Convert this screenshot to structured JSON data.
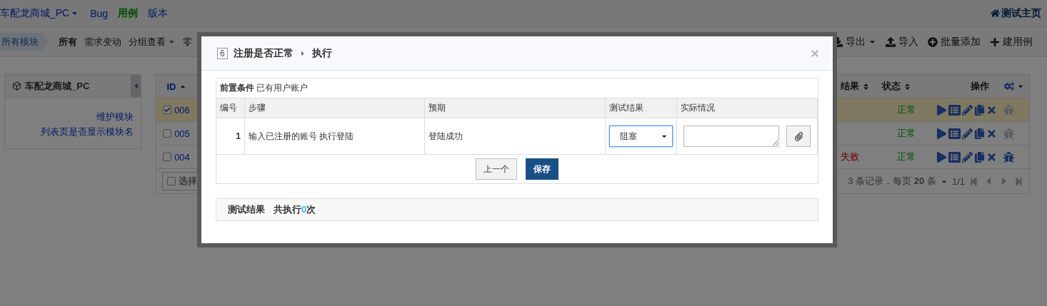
{
  "top_nav": {
    "product": "车配龙商城_PC",
    "items": [
      {
        "label": "Bug",
        "selected": false
      },
      {
        "label": "用例",
        "selected": true
      },
      {
        "label": "版本",
        "selected": false
      }
    ],
    "home_link": "测试主页"
  },
  "toolbar": {
    "breadcrumb": "所有模块",
    "filters": [
      {
        "label": "所有",
        "selected": true,
        "dropdown": false
      },
      {
        "label": "需求变动",
        "selected": false,
        "dropdown": false
      },
      {
        "label": "分组查看",
        "selected": false,
        "dropdown": true
      },
      {
        "label": "零",
        "selected": false,
        "dropdown": false
      }
    ],
    "actions": [
      {
        "label": "导出",
        "kind": "export",
        "dropdown": true
      },
      {
        "label": "导入",
        "kind": "import",
        "dropdown": false
      },
      {
        "label": "批量添加",
        "kind": "batch",
        "dropdown": false
      },
      {
        "label": "建用例",
        "kind": "create",
        "dropdown": false
      }
    ]
  },
  "sidebar": {
    "title": "车配龙商城_PC",
    "links": [
      "维护模块",
      "列表页是否显示模块名"
    ]
  },
  "case_table": {
    "columns": [
      {
        "label": "ID",
        "sortable": true,
        "sorted_ascending": true
      },
      {
        "label": "结果",
        "sortable": true,
        "sorted_ascending": false
      },
      {
        "label": "状态",
        "sortable": true,
        "sorted_ascending": false
      },
      {
        "label": "操作",
        "sortable": false
      }
    ],
    "rows": [
      {
        "id": "006",
        "checked": true,
        "selected": true,
        "status": "正常",
        "bug_enabled": false
      },
      {
        "id": "005",
        "checked": false,
        "selected": false,
        "status": "正常",
        "bug_enabled": false
      },
      {
        "id": "004",
        "checked": false,
        "selected": false,
        "result": "失败",
        "status": "正常",
        "bug_enabled": true
      }
    ],
    "footer": {
      "select_label": "选择",
      "checked": false,
      "summary": "3 条记录，每页 **20** 条",
      "page": "1/1"
    }
  },
  "dialog": {
    "case_number": "6",
    "title": "注册是否正常",
    "action": "执行",
    "precondition_label": "前置条件",
    "precondition": "已有用户账户",
    "columns": [
      "编号",
      "步骤",
      "预期",
      "测试结果",
      "实际情况"
    ],
    "steps": [
      {
        "number": "1",
        "step": "输入已注册的账号 执行登陆",
        "expected": "登陆成功",
        "result": "阻塞"
      }
    ],
    "buttons": [
      {
        "label": "上一个",
        "kind": "default"
      },
      {
        "label": "保存",
        "kind": "primary"
      }
    ],
    "results_label": "测试结果",
    "run_prefix": "共执行",
    "run_count": "0",
    "run_suffix": "次"
  }
}
